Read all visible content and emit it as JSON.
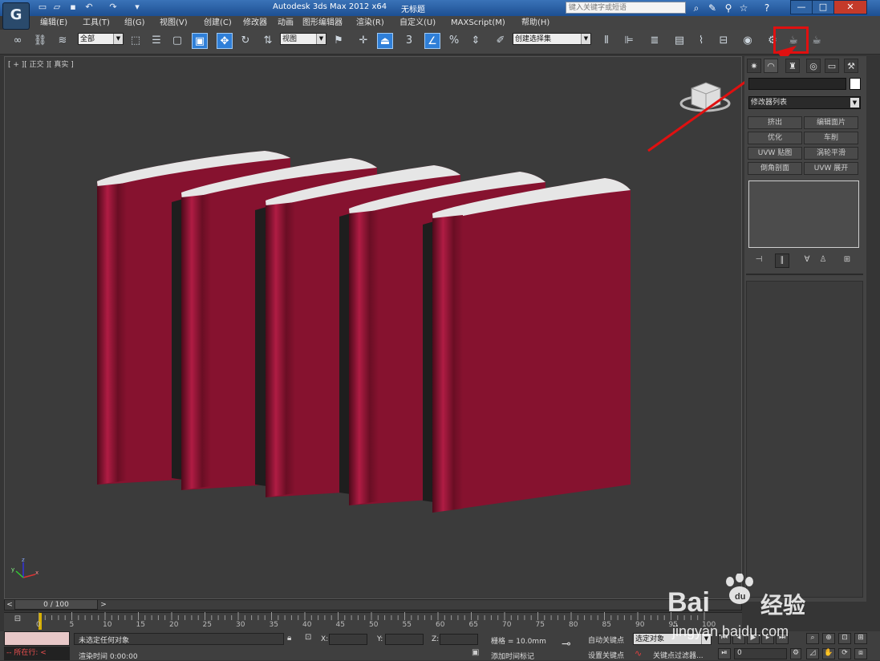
{
  "window": {
    "app_title": "Autodesk 3ds Max  2012 x64",
    "doc_title": "无标题",
    "search_placeholder": "键入关键字或短语",
    "min": "—",
    "max": "□",
    "close": "✕"
  },
  "menu": [
    "编辑(E)",
    "工具(T)",
    "组(G)",
    "视图(V)",
    "创建(C)",
    "修改器",
    "动画",
    "图形编辑器",
    "渲染(R)",
    "自定义(U)",
    "MAXScript(M)",
    "帮助(H)"
  ],
  "toolbar": {
    "selection_filter": "全部",
    "reference_coord": "视图",
    "named_selection": "创建选择集",
    "snap_number": "3"
  },
  "viewport": {
    "label": "[ + ][ 正交 ][ 真实 ]"
  },
  "command_panel": {
    "modifier_list": "修改器列表",
    "modifiers": [
      "挤出",
      "编辑面片",
      "优化",
      "车削",
      "UVW 贴图",
      "涡轮平滑",
      "倒角剖面",
      "UVW 展开"
    ]
  },
  "time_slider": {
    "frame": "0 / 100",
    "ticks": [
      "0",
      "5",
      "10",
      "15",
      "20",
      "25",
      "30",
      "35",
      "40",
      "45",
      "50",
      "55",
      "60",
      "65",
      "70",
      "75",
      "80",
      "85",
      "90",
      "95",
      "100"
    ]
  },
  "status": {
    "listener": "-- 所在行:  <",
    "selection": "未选定任何对象",
    "render_time": "渲染时间  0:00:00",
    "x_label": "X:",
    "y_label": "Y:",
    "z_label": "Z:",
    "grid": "栅格 = 10.0mm",
    "add_time_tag": "添加时间标记",
    "auto_key": "自动关键点",
    "set_key": "设置关键点",
    "key_mode": "选定对象",
    "key_filters": "关键点过滤器...",
    "frame_field": "0"
  },
  "watermark": {
    "brand": "Bai",
    "suffix": "经验",
    "url": "jingyan.baidu.com"
  },
  "colors": {
    "book_cover": "#86122f",
    "book_pages": "#e6e6e6",
    "highlight": "#e01010"
  }
}
